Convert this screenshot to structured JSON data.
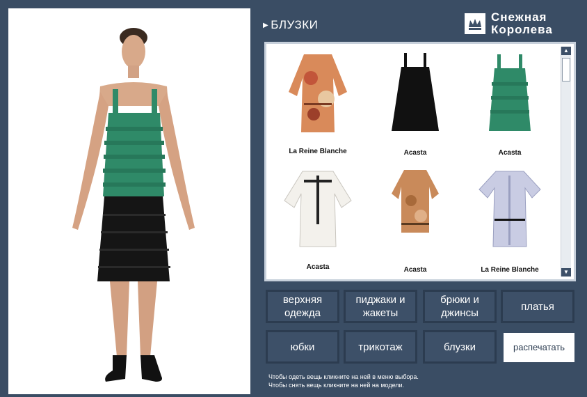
{
  "header": {
    "section_title": "БЛУЗКИ",
    "brand_line1": "Снежная",
    "brand_line2": "Королева"
  },
  "catalog": {
    "items": [
      {
        "label": "La Reine Blanche",
        "icon": "floral-blouse"
      },
      {
        "label": "Acasta",
        "icon": "black-pleated-top"
      },
      {
        "label": "Acasta",
        "icon": "green-ruffled-top"
      },
      {
        "label": "Acasta",
        "icon": "white-embroidered-blouse"
      },
      {
        "label": "Acasta",
        "icon": "print-blouse"
      },
      {
        "label": "La Reine Blanche",
        "icon": "striped-shirt"
      }
    ]
  },
  "categories": [
    {
      "label": "верхняя одежда"
    },
    {
      "label": "пиджаки и жакеты"
    },
    {
      "label": "брюки и джинсы"
    },
    {
      "label": "платья"
    },
    {
      "label": "юбки"
    },
    {
      "label": "трикотаж"
    },
    {
      "label": "блузки"
    }
  ],
  "print_button": "распечатать",
  "hints": [
    "Чтобы одеть вещь кликните на ней в меню выбора.",
    "Чтобы снять вещь кликните на ней на модели."
  ],
  "colors": {
    "panel": "#3d5068",
    "button_border": "#2c3c50",
    "green_top": "#2f8a68",
    "skirt": "#151515"
  }
}
